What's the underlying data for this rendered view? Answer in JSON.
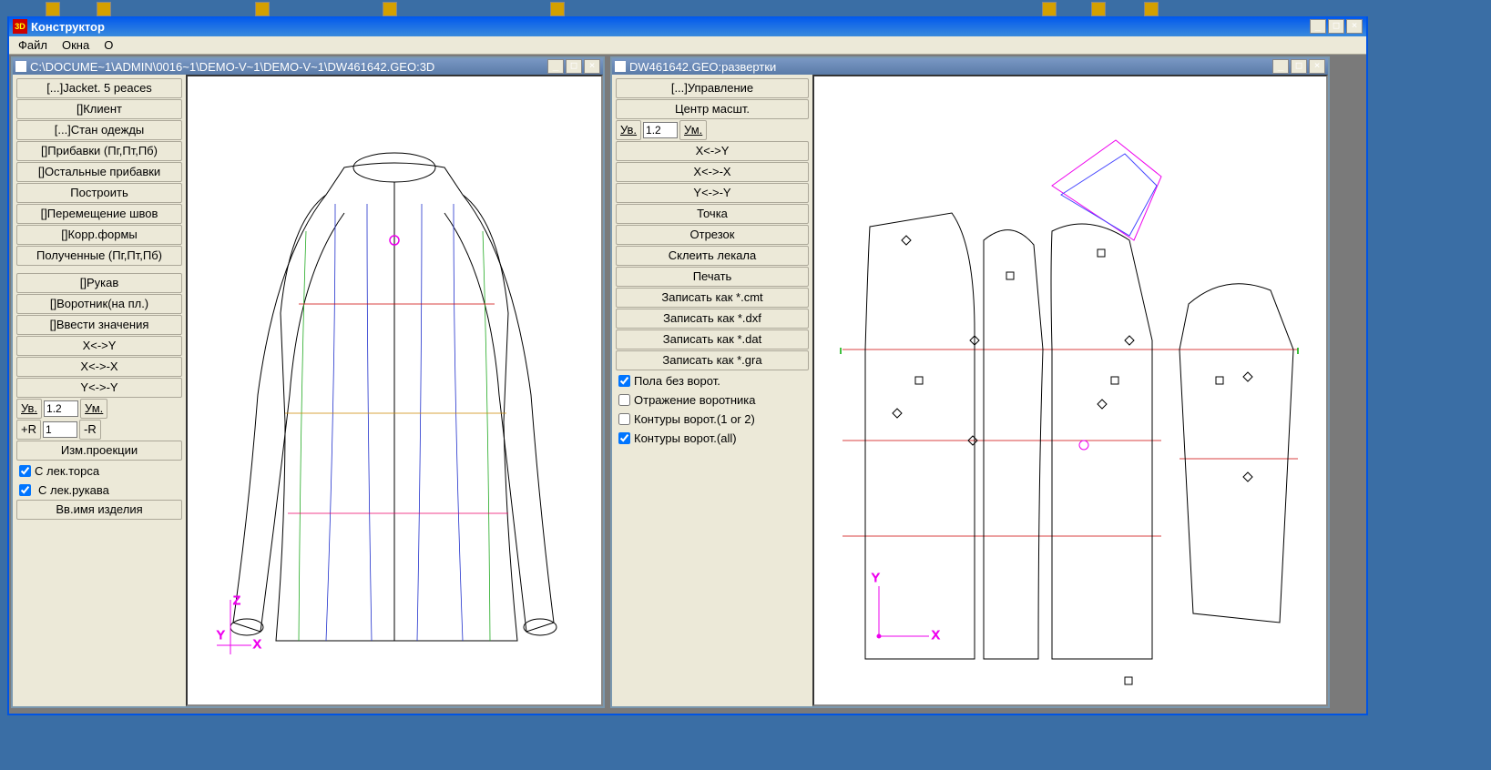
{
  "app": {
    "title": "Конструктор",
    "menu": {
      "file": "Файл",
      "windows": "Окна",
      "about": "О"
    }
  },
  "left_window": {
    "title": "C:\\DOCUME~1\\ADMIN\\0016~1\\DEMO-V~1\\DEMO-V~1\\DW461642.GEO:3D",
    "panel": {
      "jacket": "[...]Jacket. 5 peaces",
      "client": "[]Клиент",
      "stan": "[...]Стан одежды",
      "pribavki": "[]Прибавки (Пг,Пт,Пб)",
      "ost_pribavki": "[]Остальные прибавки",
      "postroit": "Построить",
      "perem_shvov": "[]Перемещение швов",
      "korr_formy": "[]Корр.формы",
      "poluch": "Полученные (Пг,Пт,Пб)",
      "rukav": "[]Рукав",
      "vorotnik": "[]Воротник(на пл.)",
      "vvesti": "[]Ввести значения",
      "xy": "X<->Y",
      "xx": "X<->-X",
      "yy": "Y<->-Y",
      "uv": "Ув.",
      "zoom_val": "1.2",
      "um": "Ум.",
      "plus_r": "+R",
      "r_val": "1",
      "minus_r": "-R",
      "izm_proj": "Изм.проекции",
      "chk_torsa": "С лек.торса",
      "chk_rukava": "С лек.рукава",
      "vv_name": "Вв.имя изделия"
    }
  },
  "right_window": {
    "title": "DW461642.GEO:развертки",
    "panel": {
      "upr": "[...]Управление",
      "centr": "Центр масшт.",
      "uv": "Ув.",
      "zoom_val": "1.2",
      "um": "Ум.",
      "xy": "X<->Y",
      "xx": "X<->-X",
      "yy": "Y<->-Y",
      "tochka": "Точка",
      "otrezok": "Отрезок",
      "skleit": "Склеить лекала",
      "pechat": "Печать",
      "save_cmt": "Записать как *.cmt",
      "save_dxf": "Записать как *.dxf",
      "save_dat": "Записать как *.dat",
      "save_gra": "Записать как *.gra",
      "chk_pola": "Пола без ворот.",
      "chk_otr": "Отражение воротника",
      "chk_kont1": "Контуры ворот.(1 or 2)",
      "chk_kontall": "Контуры ворот.(all)"
    }
  }
}
